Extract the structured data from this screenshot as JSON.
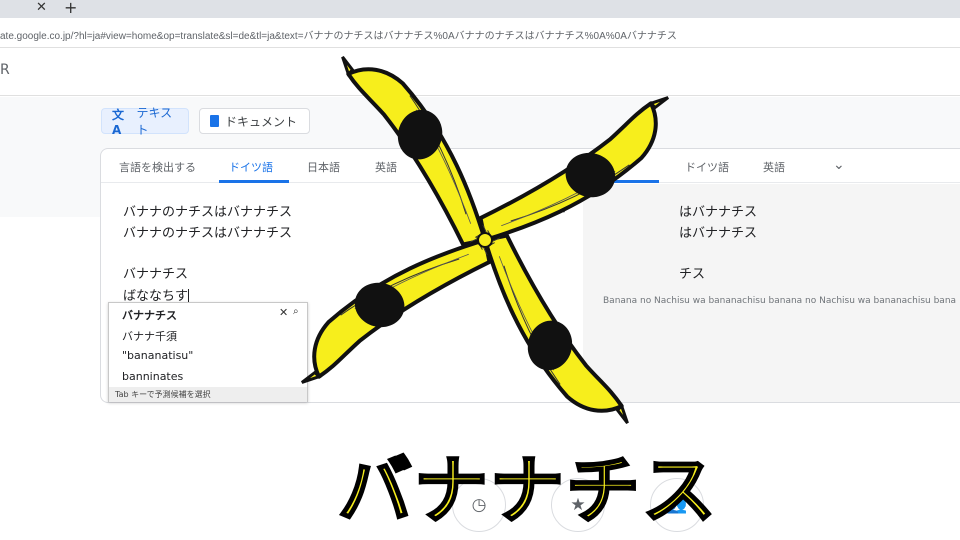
{
  "browser": {
    "tab_close_icon": "close-icon",
    "new_tab_icon": "plus-icon",
    "tab_close_glyph": "✕",
    "new_tab_glyph": "+",
    "url": "ate.google.co.jp/?hl=ja#view=home&op=translate&sl=de&tl=ja&text=バナナのナチスはバナナチス%0Aバナナのナチスはバナナチス%0A%0Aバナナチス"
  },
  "app": {
    "title": "R"
  },
  "modes": [
    {
      "label": "テキスト",
      "icon": "translate-icon",
      "active": true
    },
    {
      "label": "ドキュメント",
      "icon": "document-icon",
      "active": false
    }
  ],
  "source_langs": {
    "detect": "言語を検出する",
    "german": "ドイツ語",
    "japanese": "日本語",
    "english": "英語"
  },
  "target_langs": {
    "german": "ドイツ語",
    "english": "英語"
  },
  "source_text": {
    "line1": "バナナのナチスはバナナチス",
    "line2": "バナナのナチスはバナナチス",
    "line3": "バナナチス",
    "composing": "ばななちす"
  },
  "output_text": {
    "line1": "はバナナチス",
    "line2": "はバナナチス",
    "line3": "チス",
    "romaji": "Banana no Nachisu wa bananachisu banana no Nachisu wa bananachisu bana"
  },
  "ime": {
    "candidates": [
      "バナナチス",
      "バナナ千須",
      "\"bananatisu\"",
      "banninates"
    ],
    "footer": "Tab キーで予測候補を選択"
  },
  "overlay": {
    "caption": "バナナチス",
    "banana_color": "#f7ee1c",
    "spot_color": "#111111"
  },
  "bottom_icons": [
    "history-icon",
    "saved-icon",
    "community-icon"
  ],
  "colors": {
    "accent": "#1a73e8"
  }
}
